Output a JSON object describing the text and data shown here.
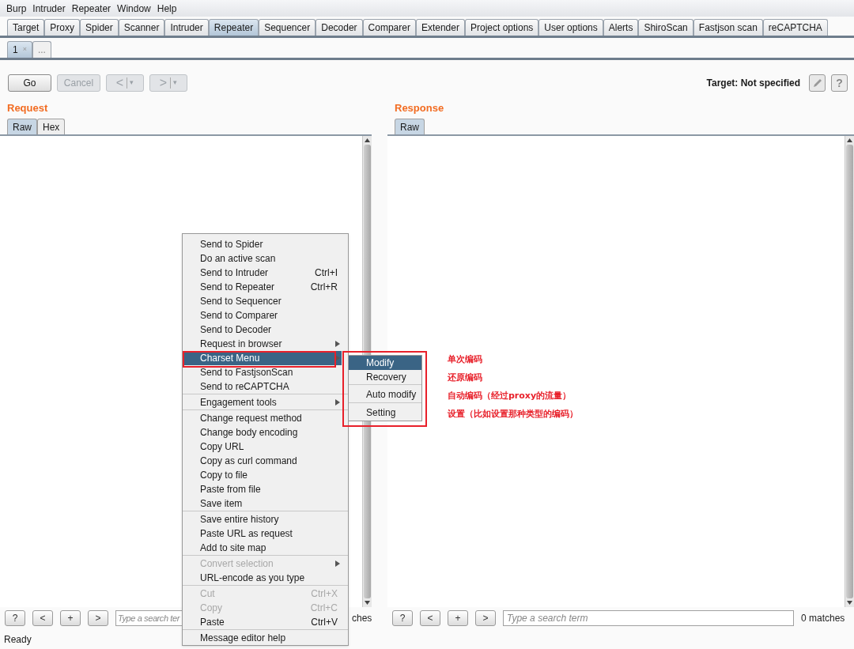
{
  "menu_bar": [
    "Burp",
    "Intruder",
    "Repeater",
    "Window",
    "Help"
  ],
  "tabs": [
    {
      "label": "Target",
      "selected": false
    },
    {
      "label": "Proxy",
      "selected": false
    },
    {
      "label": "Spider",
      "selected": false
    },
    {
      "label": "Scanner",
      "selected": false
    },
    {
      "label": "Intruder",
      "selected": false
    },
    {
      "label": "Repeater",
      "selected": true
    },
    {
      "label": "Sequencer",
      "selected": false
    },
    {
      "label": "Decoder",
      "selected": false
    },
    {
      "label": "Comparer",
      "selected": false
    },
    {
      "label": "Extender",
      "selected": false
    },
    {
      "label": "Project options",
      "selected": false
    },
    {
      "label": "User options",
      "selected": false
    },
    {
      "label": "Alerts",
      "selected": false
    },
    {
      "label": "ShiroScan",
      "selected": false
    },
    {
      "label": "Fastjson scan",
      "selected": false
    },
    {
      "label": "reCAPTCHA",
      "selected": false
    }
  ],
  "sub_tabs": [
    {
      "label": "1",
      "close": "×",
      "selected": true
    },
    {
      "label": "...",
      "selected": false
    }
  ],
  "toolbar": {
    "go": {
      "label": "Go",
      "disabled": false
    },
    "cancel": {
      "label": "Cancel",
      "disabled": true
    },
    "back": {
      "label": "<",
      "caret": "▾",
      "disabled": true
    },
    "forward": {
      "label": ">",
      "caret": "▾",
      "disabled": true
    },
    "target": "Target: Not specified",
    "help": "?"
  },
  "request": {
    "title": "Request",
    "tabs": [
      {
        "label": "Raw",
        "selected": true
      },
      {
        "label": "Hex",
        "selected": false
      }
    ],
    "bottom": {
      "buttons": [
        "?",
        "<",
        "+",
        ">"
      ],
      "placeholder": "Type a search ter",
      "matches": "ches"
    }
  },
  "response": {
    "title": "Response",
    "tabs": [
      {
        "label": "Raw",
        "selected": true
      }
    ],
    "bottom": {
      "buttons": [
        "?",
        "<",
        "+",
        ">"
      ],
      "placeholder": "Type a search term",
      "matches": "0 matches"
    }
  },
  "status_bar": "Ready",
  "context_menu": [
    [
      {
        "label": "Send to Spider",
        "submenu": false,
        "disabled": false,
        "selected": false
      },
      {
        "label": "Do an active scan",
        "submenu": false,
        "disabled": false,
        "selected": false
      },
      {
        "label": "Send to Intruder",
        "shortcut": "Ctrl+I",
        "submenu": false,
        "disabled": false,
        "selected": false
      },
      {
        "label": "Send to Repeater",
        "shortcut": "Ctrl+R",
        "submenu": false,
        "disabled": false,
        "selected": false
      },
      {
        "label": "Send to Sequencer",
        "submenu": false,
        "disabled": false,
        "selected": false
      },
      {
        "label": "Send to Comparer",
        "submenu": false,
        "disabled": false,
        "selected": false
      },
      {
        "label": "Send to Decoder",
        "submenu": false,
        "disabled": false,
        "selected": false
      },
      {
        "label": "Request in browser",
        "submenu": true,
        "disabled": false,
        "selected": false
      },
      {
        "label": "Charset Menu",
        "submenu": true,
        "disabled": false,
        "selected": true
      },
      {
        "label": "Send to FastjsonScan",
        "submenu": false,
        "disabled": false,
        "selected": false
      },
      {
        "label": "Send to reCAPTCHA",
        "submenu": false,
        "disabled": false,
        "selected": false
      }
    ],
    [
      {
        "label": "Engagement tools",
        "submenu": true,
        "disabled": false,
        "selected": false
      }
    ],
    [
      {
        "label": "Change request method",
        "submenu": false,
        "disabled": false,
        "selected": false
      },
      {
        "label": "Change body encoding",
        "submenu": false,
        "disabled": false,
        "selected": false
      },
      {
        "label": "Copy URL",
        "submenu": false,
        "disabled": false,
        "selected": false
      },
      {
        "label": "Copy as curl command",
        "submenu": false,
        "disabled": false,
        "selected": false
      },
      {
        "label": "Copy to file",
        "submenu": false,
        "disabled": false,
        "selected": false
      },
      {
        "label": "Paste from file",
        "submenu": false,
        "disabled": false,
        "selected": false
      },
      {
        "label": "Save item",
        "submenu": false,
        "disabled": false,
        "selected": false
      }
    ],
    [
      {
        "label": "Save entire history",
        "submenu": false,
        "disabled": false,
        "selected": false
      },
      {
        "label": "Paste URL as request",
        "submenu": false,
        "disabled": false,
        "selected": false
      },
      {
        "label": "Add to site map",
        "submenu": false,
        "disabled": false,
        "selected": false
      }
    ],
    [
      {
        "label": "Convert selection",
        "submenu": true,
        "disabled": true,
        "selected": false
      },
      {
        "label": "URL-encode as you type",
        "submenu": false,
        "disabled": false,
        "selected": false
      }
    ],
    [
      {
        "label": "Cut",
        "shortcut": "Ctrl+X",
        "submenu": false,
        "disabled": true,
        "selected": false
      },
      {
        "label": "Copy",
        "shortcut": "Ctrl+C",
        "submenu": false,
        "disabled": true,
        "selected": false
      },
      {
        "label": "Paste",
        "shortcut": "Ctrl+V",
        "submenu": false,
        "disabled": false,
        "selected": false
      }
    ],
    [
      {
        "label": "Message editor help",
        "submenu": false,
        "disabled": false,
        "selected": false
      }
    ]
  ],
  "submenu": [
    [
      {
        "label": "Modify",
        "selected": true
      },
      {
        "label": "Recovery",
        "selected": false
      }
    ],
    [
      {
        "label": "Auto modify",
        "selected": false
      }
    ],
    [
      {
        "label": "Setting",
        "selected": false
      }
    ]
  ],
  "annotations": [
    "单次编码",
    "还原编码",
    "自动编码（经过proxy的流量）",
    "设置（比如设置那种类型的编码）"
  ]
}
